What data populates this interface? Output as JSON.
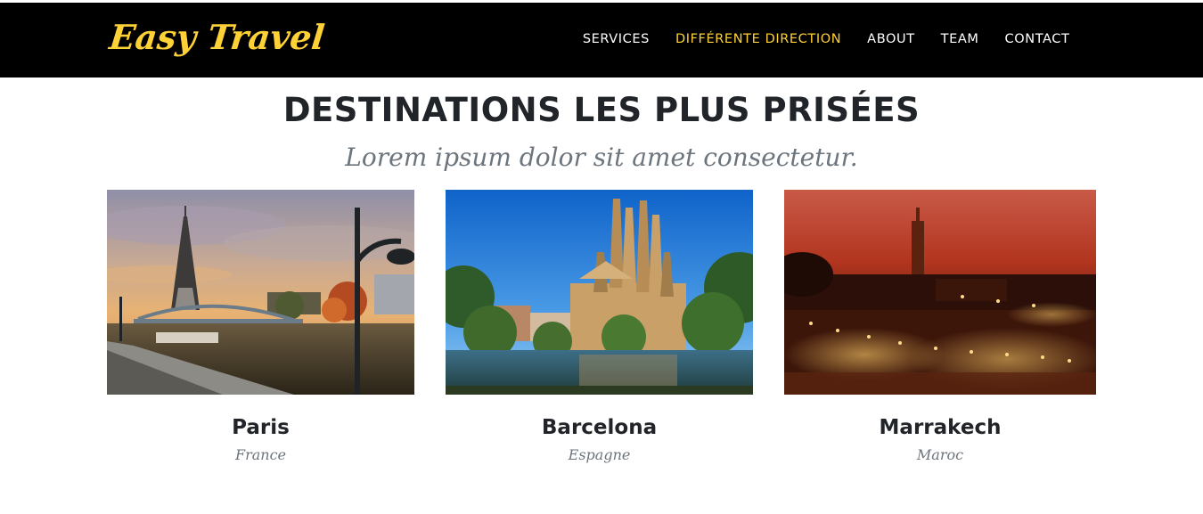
{
  "navbar": {
    "brand": "Easy Travel",
    "links": [
      {
        "label": "SERVICES",
        "active": false
      },
      {
        "label": "DIFFÉRENTE DIRECTION",
        "active": true
      },
      {
        "label": "ABOUT",
        "active": false
      },
      {
        "label": "TEAM",
        "active": false
      },
      {
        "label": "CONTACT",
        "active": false
      }
    ],
    "background": "#000000",
    "accent": "#fed136"
  },
  "section": {
    "heading": "DESTINATIONS LES PLUS PRISÉES",
    "subheading": "Lorem ipsum dolor sit amet consectetur."
  },
  "destinations": [
    {
      "city": "Paris",
      "country": "France",
      "image": "eiffel-tower-seine-sunset"
    },
    {
      "city": "Barcelona",
      "country": "Espagne",
      "image": "sagrada-familia-pond"
    },
    {
      "city": "Marrakech",
      "country": "Maroc",
      "image": "jemaa-el-fnaa-night"
    }
  ]
}
